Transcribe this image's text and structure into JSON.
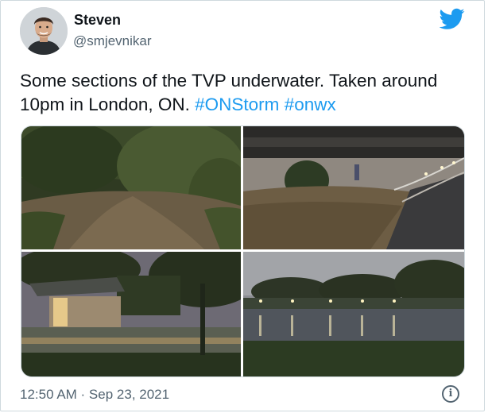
{
  "author": {
    "name": "Steven",
    "handle": "@smjevnikar",
    "avatar_icon": "person-avatar-icon"
  },
  "tweet": {
    "text_parts": [
      "Some sections of the TVP underwater. Taken around 10pm in London, ON. "
    ],
    "hashtags": [
      "#ONStorm",
      "#onwx"
    ]
  },
  "media": {
    "photos": [
      "flooded-path-woods-photo",
      "flooded-trail-under-bridge-photo",
      "flooded-park-shelter-photo",
      "flooded-park-night-lights-photo"
    ]
  },
  "footer": {
    "timestamp": "12:50 AM · Sep 23, 2021",
    "info_icon": "info-icon"
  },
  "colors": {
    "link": "#1d9bf0",
    "twitter_bird": "#1d9bf0",
    "secondary_text": "#536471"
  }
}
